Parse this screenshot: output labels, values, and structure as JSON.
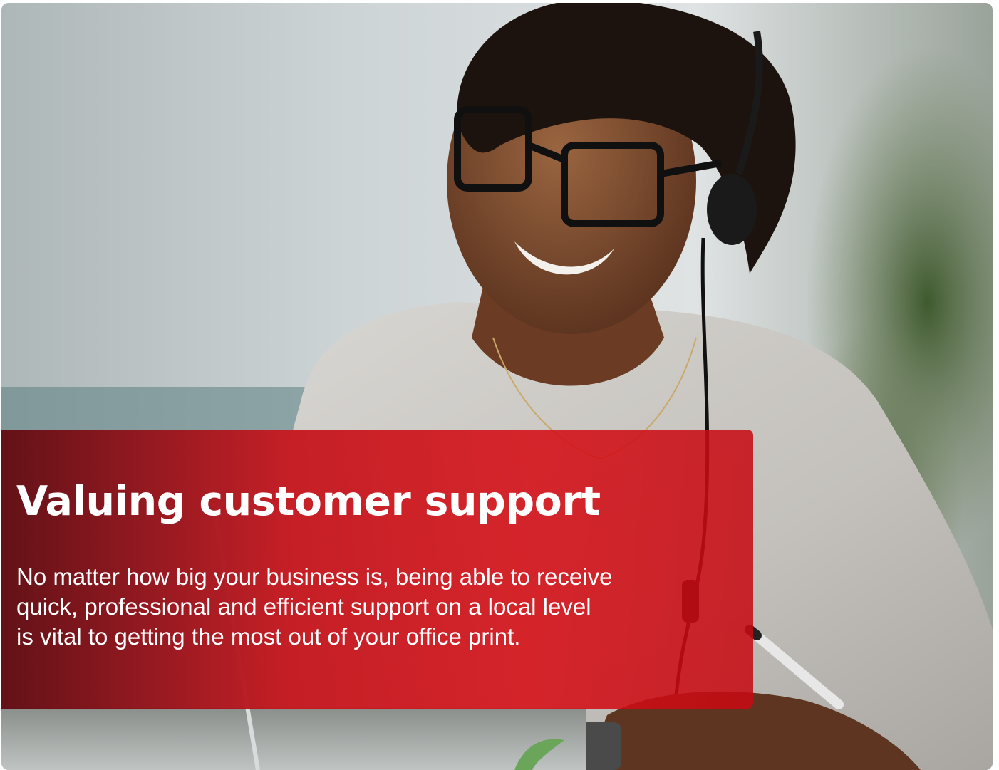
{
  "hero": {
    "title": "Valuing customer support",
    "description_lines": [
      "No matter how big your business is, being able to receive",
      "quick, professional and efficient support on a local level",
      "is vital to getting the most out of your office print."
    ]
  },
  "colors": {
    "accent_red": "#d50e16",
    "text": "#ffffff"
  }
}
